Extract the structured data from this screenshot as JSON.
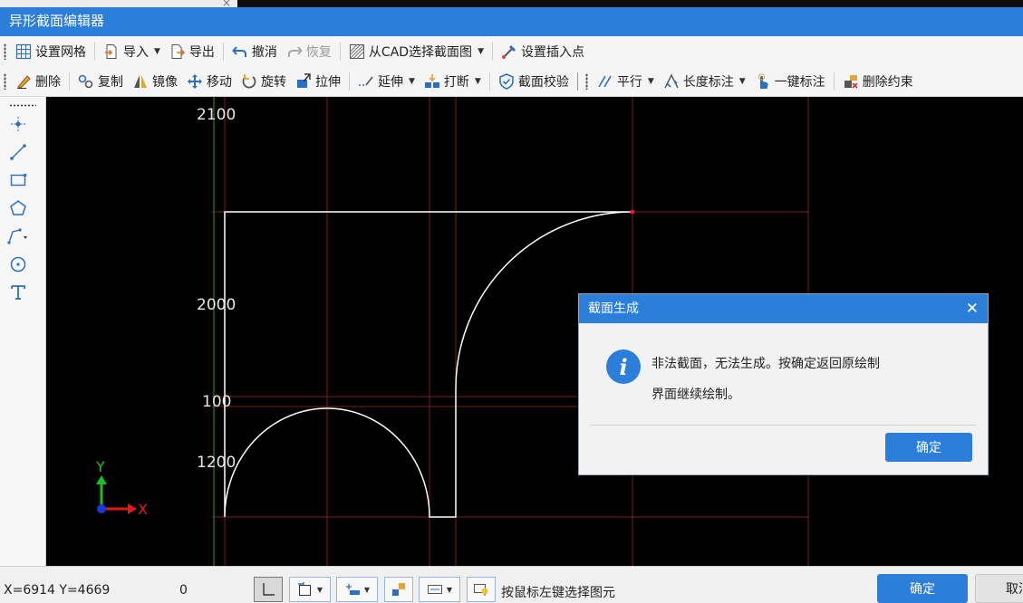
{
  "window": {
    "title": "异形截面编辑器"
  },
  "toolbar1": {
    "set_grid": "设置网格",
    "import": "导入",
    "export": "导出",
    "undo": "撤消",
    "redo": "恢复",
    "from_cad": "从CAD选择截面图",
    "set_insert_point": "设置插入点"
  },
  "toolbar2": {
    "delete": "删除",
    "copy": "复制",
    "mirror": "镜像",
    "move": "移动",
    "rotate": "旋转",
    "stretch": "拉伸",
    "extend": "延伸",
    "break": "打断",
    "section_check": "截面校验",
    "parallel": "平行",
    "length_dim": "长度标注",
    "one_key_dim": "一键标注",
    "delete_constraint": "删除约束"
  },
  "left_tools": [
    "point-tool",
    "line-tool",
    "rectangle-tool",
    "polygon-tool",
    "polyline-tool",
    "circle-tool",
    "text-tool"
  ],
  "canvas": {
    "dim_labels": [
      "2100",
      "2000",
      "100",
      "1200"
    ],
    "axis_x": "X",
    "axis_y": "Y"
  },
  "dialog": {
    "title": "截面生成",
    "message_line1": "非法截面，无法生成。按确定返回原绘制",
    "message_line2": "界面继续绘制。",
    "ok": "确定"
  },
  "statusbar": {
    "coords": "X=6914 Y=4669",
    "value": "0",
    "hint": "按鼠标左键选择图元",
    "ok": "确定",
    "cancel": "取消"
  },
  "colors": {
    "accent": "#2b7ed9",
    "grid_line": "#7a1f1f",
    "green_axis": "#1fa21f",
    "section_line": "#ffffff"
  }
}
